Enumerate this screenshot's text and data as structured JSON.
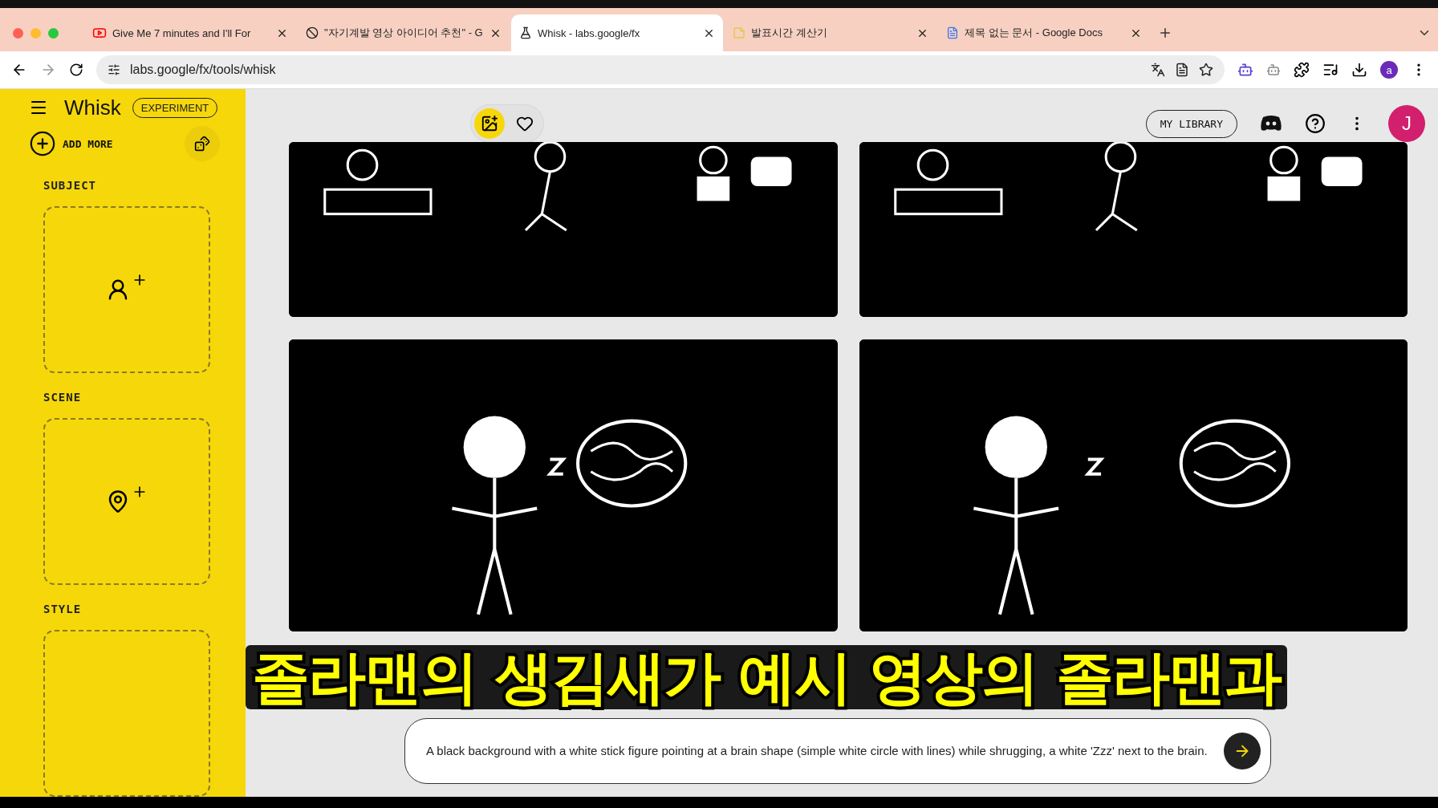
{
  "browser": {
    "tabs": [
      {
        "title": "Give Me 7 minutes and I'll For",
        "kind": "video",
        "selected": false
      },
      {
        "title": "\"자기계발 영상 아이디어 추천\" - G",
        "kind": "chat",
        "selected": false
      },
      {
        "title": "Whisk - labs.google/fx",
        "kind": "flask",
        "selected": true
      },
      {
        "title": "발표시간 계산기",
        "kind": "note",
        "selected": false
      },
      {
        "title": "제목 없는 문서 - Google Docs",
        "kind": "doc",
        "selected": false
      }
    ],
    "address": "labs.google/fx/tools/whisk",
    "profile_initial": "a"
  },
  "sidebar": {
    "app_name": "Whisk",
    "badge": "EXPERIMENT",
    "add_more": "ADD MORE",
    "sections": [
      {
        "title": "SUBJECT",
        "kind": "subject"
      },
      {
        "title": "SCENE",
        "kind": "scene"
      },
      {
        "title": "STYLE",
        "kind": "style"
      }
    ]
  },
  "header": {
    "library": "MY LIBRARY",
    "avatar_initial": "J"
  },
  "caption": "졸라맨의 생김새가 예시 영상의 졸라맨과",
  "prompt": {
    "value": "A black background with a white stick figure pointing at a brain shape (simple white circle with lines) while shrugging, a white 'Zzz' next to the brain."
  }
}
